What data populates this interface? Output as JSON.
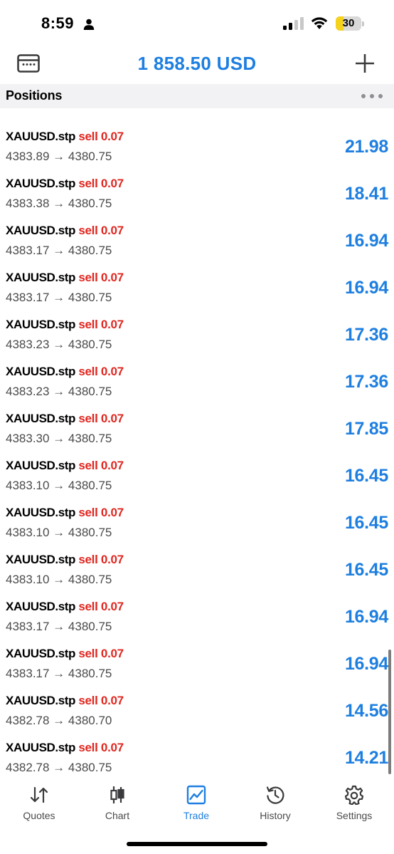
{
  "status_bar": {
    "time": "8:59",
    "battery": "30",
    "battery_level": 0.3
  },
  "header": {
    "balance": "1 858.50 USD"
  },
  "positions": {
    "title": "Positions",
    "rows": [
      {
        "symbol": "XAUUSD.stp",
        "side": "sell 0.07",
        "open": "4383.89",
        "current": "4380.75",
        "profit": "21.98"
      },
      {
        "symbol": "XAUUSD.stp",
        "side": "sell 0.07",
        "open": "4383.38",
        "current": "4380.75",
        "profit": "18.41"
      },
      {
        "symbol": "XAUUSD.stp",
        "side": "sell 0.07",
        "open": "4383.17",
        "current": "4380.75",
        "profit": "16.94"
      },
      {
        "symbol": "XAUUSD.stp",
        "side": "sell 0.07",
        "open": "4383.17",
        "current": "4380.75",
        "profit": "16.94"
      },
      {
        "symbol": "XAUUSD.stp",
        "side": "sell 0.07",
        "open": "4383.23",
        "current": "4380.75",
        "profit": "17.36"
      },
      {
        "symbol": "XAUUSD.stp",
        "side": "sell 0.07",
        "open": "4383.23",
        "current": "4380.75",
        "profit": "17.36"
      },
      {
        "symbol": "XAUUSD.stp",
        "side": "sell 0.07",
        "open": "4383.30",
        "current": "4380.75",
        "profit": "17.85"
      },
      {
        "symbol": "XAUUSD.stp",
        "side": "sell 0.07",
        "open": "4383.10",
        "current": "4380.75",
        "profit": "16.45"
      },
      {
        "symbol": "XAUUSD.stp",
        "side": "sell 0.07",
        "open": "4383.10",
        "current": "4380.75",
        "profit": "16.45"
      },
      {
        "symbol": "XAUUSD.stp",
        "side": "sell 0.07",
        "open": "4383.10",
        "current": "4380.75",
        "profit": "16.45"
      },
      {
        "symbol": "XAUUSD.stp",
        "side": "sell 0.07",
        "open": "4383.17",
        "current": "4380.75",
        "profit": "16.94"
      },
      {
        "symbol": "XAUUSD.stp",
        "side": "sell 0.07",
        "open": "4383.17",
        "current": "4380.75",
        "profit": "16.94"
      },
      {
        "symbol": "XAUUSD.stp",
        "side": "sell 0.07",
        "open": "4382.78",
        "current": "4380.70",
        "profit": "14.56"
      },
      {
        "symbol": "XAUUSD.stp",
        "side": "sell 0.07",
        "open": "4382.78",
        "current": "4380.75",
        "profit": "14.21"
      }
    ]
  },
  "tabs": [
    {
      "label": "Quotes",
      "icon": "quotes-icon",
      "active": false
    },
    {
      "label": "Chart",
      "icon": "chart-icon",
      "active": false
    },
    {
      "label": "Trade",
      "icon": "trade-icon",
      "active": true
    },
    {
      "label": "History",
      "icon": "history-icon",
      "active": false
    },
    {
      "label": "Settings",
      "icon": "settings-icon",
      "active": false
    }
  ],
  "colors": {
    "accent": "#1e7fe0",
    "sell": "#e0261f",
    "battery": "#f5d21b"
  }
}
